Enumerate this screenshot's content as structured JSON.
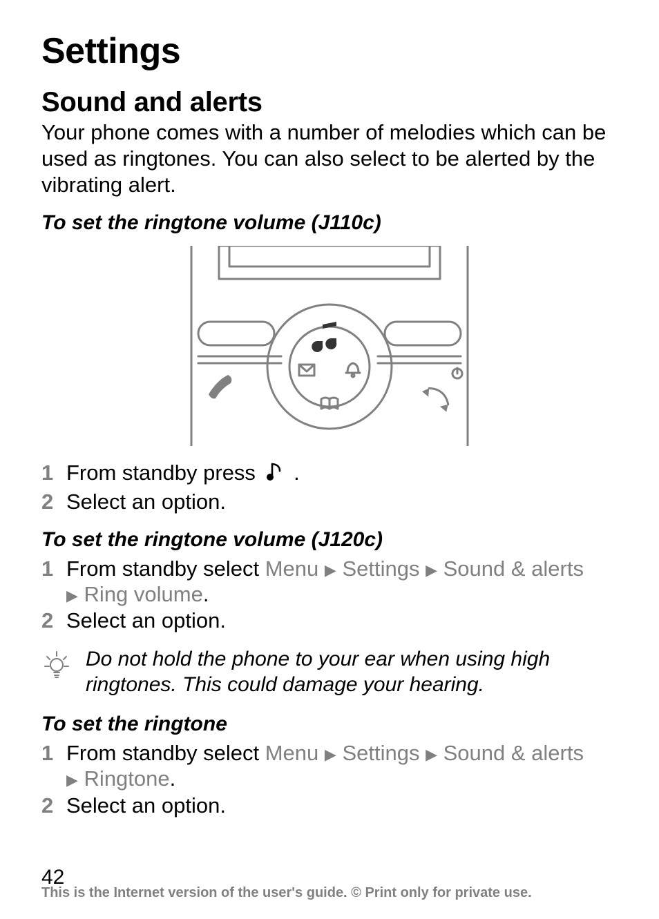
{
  "title": "Settings",
  "section_sound": {
    "heading": "Sound and alerts",
    "intro": "Your phone comes with a number of melodies which can be used as ringtones. You can also select to be alerted by the vibrating alert."
  },
  "proc_j110c": {
    "heading": "To set the ringtone volume (J110c)",
    "step1_num": "1",
    "step1_text_a": "From standby press ",
    "step1_text_b": " .",
    "step2_num": "2",
    "step2_text": "Select an option."
  },
  "proc_j120c": {
    "heading": "To set the ringtone volume (J120c)",
    "step1_num": "1",
    "step1_text_a": "From standby select ",
    "step1_menu": "Menu",
    "step1_settings": "Settings",
    "step1_sound": "Sound & alerts",
    "step1_ring": "Ring volume",
    "step2_num": "2",
    "step2_text": "Select an option."
  },
  "note": {
    "text": "Do not hold the phone to your ear when using high ringtones. This could damage your hearing."
  },
  "proc_ringtone": {
    "heading": "To set the ringtone",
    "step1_num": "1",
    "step1_text_a": "From standby select ",
    "step1_menu": "Menu",
    "step1_settings": "Settings",
    "step1_sound": "Sound & alerts",
    "step1_ringtone": "Ringtone",
    "step2_num": "2",
    "step2_text": "Select an option."
  },
  "arrow": "▶",
  "period": ".",
  "footer": {
    "page": "42",
    "line": "This is the Internet version of the user's guide. © Print only for private use."
  }
}
